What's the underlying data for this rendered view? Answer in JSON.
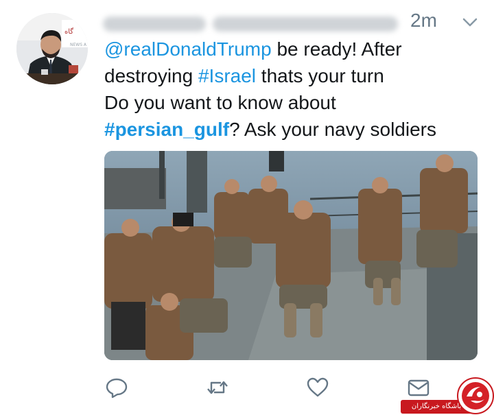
{
  "tweet": {
    "timestamp": "2m",
    "text": {
      "line1_mention": "@realDonaldTrump",
      "line1_rest": " be ready! After",
      "line2_before": "destroying ",
      "line2_hashtag": "#Israel",
      "line2_after": " thats your turn",
      "line3": "Do you want to know about",
      "line4_hashtag": "#persian_gulf",
      "line4_after": "? Ask your navy soldiers"
    },
    "actions": {
      "reply": "reply-icon",
      "retweet": "retweet-icon",
      "like": "heart-icon",
      "message": "envelope-icon"
    }
  },
  "watermark": {
    "text": "باشگاه خبرنگاران"
  },
  "colors": {
    "link": "#1b95e0",
    "text": "#14171a",
    "muted": "#657786",
    "watermark_red": "#c8191f"
  }
}
